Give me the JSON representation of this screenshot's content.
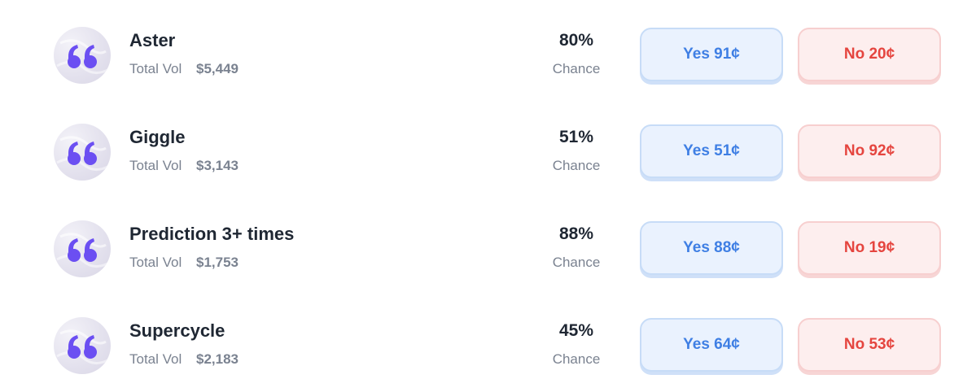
{
  "markets": [
    {
      "name": "Aster",
      "vol_label": "Total Vol",
      "vol_value": "$5,449",
      "chance_pct": "80%",
      "chance_label": "Chance",
      "yes_label": "Yes 91¢",
      "no_label": "No 20¢",
      "icon": "quote-icon"
    },
    {
      "name": "Giggle",
      "vol_label": "Total Vol",
      "vol_value": "$3,143",
      "chance_pct": "51%",
      "chance_label": "Chance",
      "yes_label": "Yes 51¢",
      "no_label": "No 92¢",
      "icon": "quote-icon"
    },
    {
      "name": "Prediction 3+ times",
      "vol_label": "Total Vol",
      "vol_value": "$1,753",
      "chance_pct": "88%",
      "chance_label": "Chance",
      "yes_label": "Yes 88¢",
      "no_label": "No 19¢",
      "icon": "quote-icon"
    },
    {
      "name": "Supercycle",
      "vol_label": "Total Vol",
      "vol_value": "$2,183",
      "chance_pct": "45%",
      "chance_label": "Chance",
      "yes_label": "Yes 64¢",
      "no_label": "No 53¢",
      "icon": "quote-icon"
    }
  ],
  "colors": {
    "yes_text": "#3f7fe4",
    "yes_bg": "#eaf2fe",
    "no_text": "#e5453f",
    "no_bg": "#fdeeee",
    "icon_accent": "#6b4ff2"
  }
}
